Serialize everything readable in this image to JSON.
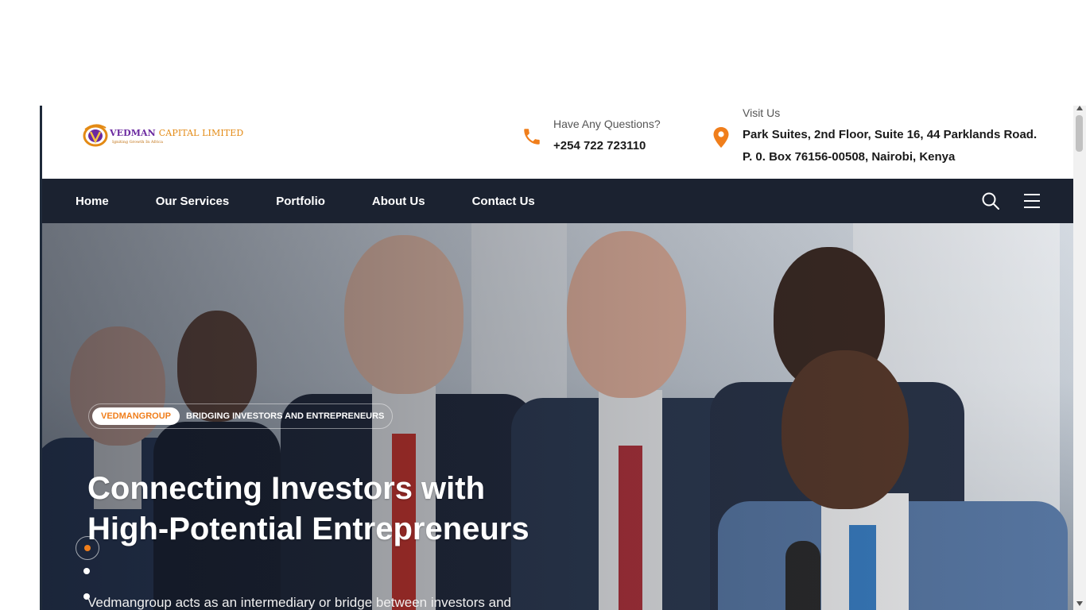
{
  "brand": {
    "name": "VEDMAN",
    "name_suffix": "CAPITAL LIMITED",
    "tagline": "Igniting Growth In Africa"
  },
  "contact": {
    "questions_label": "Have Any Questions?",
    "phone": "+254 722 723110",
    "visit_label": "Visit Us",
    "address_line1": "Park Suites, 2nd Floor, Suite 16, 44 Parklands Road.",
    "address_line2": "P. 0. Box 76156-00508, Nairobi, Kenya"
  },
  "nav": {
    "items": [
      {
        "label": "Home"
      },
      {
        "label": "Our Services"
      },
      {
        "label": "Portfolio"
      },
      {
        "label": "About Us"
      },
      {
        "label": "Contact Us"
      }
    ]
  },
  "hero": {
    "badge_pill": "VEDMANGROUP",
    "badge_text": "BRIDGING INVESTORS AND ENTREPRENEURS",
    "title_line1": "Connecting Investors with",
    "title_line2": "High-Potential Entrepreneurs",
    "description": "Vedmangroup acts as an intermediary or bridge between investors and",
    "slide_dots": 3,
    "active_slide": 1
  },
  "colors": {
    "accent": "#f07e1b",
    "nav_bg": "#1b2230",
    "brand_purple": "#6b2aa0"
  },
  "icons": [
    "phone-icon",
    "location-pin-icon",
    "search-icon",
    "hamburger-menu-icon"
  ]
}
